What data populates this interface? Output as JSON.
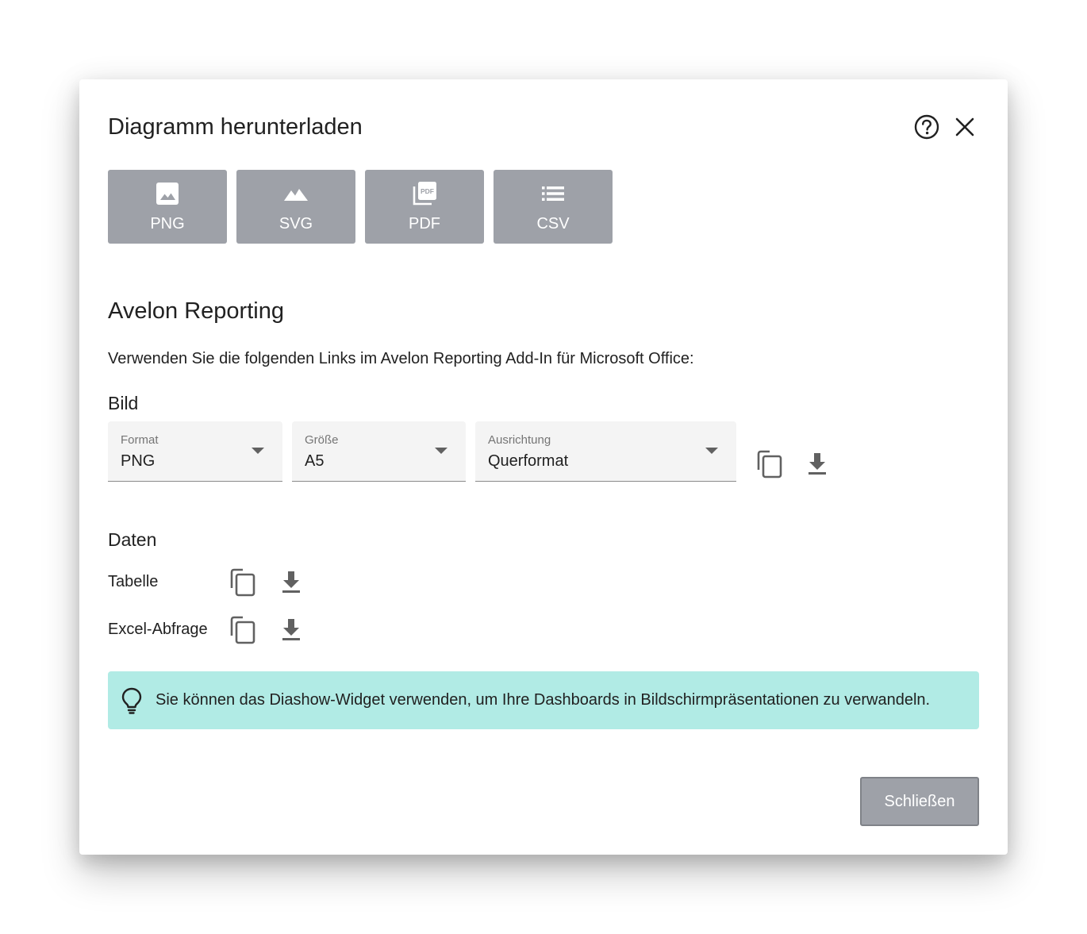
{
  "dialog": {
    "title": "Diagramm herunterladen",
    "help_icon": "help-circle-icon",
    "close_icon": "close-icon"
  },
  "formats": [
    {
      "label": "PNG",
      "icon": "image-icon"
    },
    {
      "label": "SVG",
      "icon": "landscape-icon"
    },
    {
      "label": "PDF",
      "icon": "pdf-icon"
    },
    {
      "label": "CSV",
      "icon": "list-icon"
    }
  ],
  "reporting": {
    "heading": "Avelon Reporting",
    "description": "Verwenden Sie die folgenden Links im Avelon Reporting Add-In für Microsoft Office:"
  },
  "bild": {
    "heading": "Bild",
    "format": {
      "label": "Format",
      "value": "PNG"
    },
    "size": {
      "label": "Größe",
      "value": "A5"
    },
    "orientation": {
      "label": "Ausrichtung",
      "value": "Querformat"
    }
  },
  "daten": {
    "heading": "Daten",
    "rows": [
      {
        "label": "Tabelle"
      },
      {
        "label": "Excel-Abfrage"
      }
    ]
  },
  "tip": {
    "icon": "lightbulb-icon",
    "text": "Sie können das Diashow-Widget verwenden, um Ihre Dashboards in Bildschirmpräsentationen zu verwandeln."
  },
  "footer": {
    "close_label": "Schließen"
  },
  "colors": {
    "button_grey": "#9ea1a8",
    "tip_background": "#b1ebe5",
    "field_background": "#f4f4f4"
  }
}
